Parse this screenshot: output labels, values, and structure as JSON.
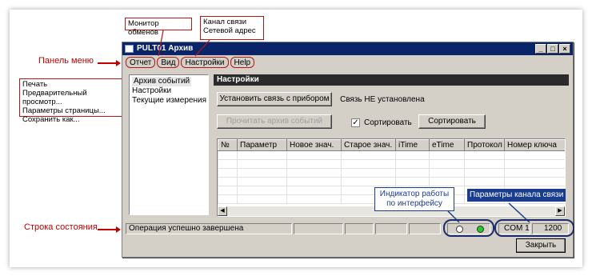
{
  "window": {
    "title": "PULT01 Архив",
    "controls": [
      "_",
      "□",
      "×"
    ]
  },
  "menu": [
    "Отчет",
    "Вид",
    "Настройки",
    "Help"
  ],
  "tree": [
    "Архив событий",
    "Настройки",
    "Текущие измерения"
  ],
  "panel": {
    "header": "Настройки",
    "connect_button": "Установить связь с прибором",
    "connect_status": "Связь НЕ установлена",
    "read_button": "Прочитать архив событий",
    "sort_checkbox_label": "Сортировать",
    "sort_checked": true,
    "sort_button": "Сортировать"
  },
  "table": {
    "columns": [
      "№",
      "Параметр",
      "Новое знач.",
      "Старое знач.",
      "iTime",
      "eTime",
      "Протокол",
      "Номер ключа"
    ]
  },
  "statusbar": {
    "message": "Операция успешно завершена",
    "port": "COM 1",
    "baud": "1200"
  },
  "close_button": "Закрыть",
  "annotations": {
    "monitor": "Монитор обменов",
    "channel_line1": "Канал связи",
    "channel_line2": "Сетевой адрес",
    "menu_panel": "Панель меню",
    "report_items": [
      "Печать",
      "Предварительный просмотр...",
      "Параметры страницы...",
      "Сохранить как..."
    ],
    "status_row": "Строка состояния",
    "indicator_line1": "Индикатор работы",
    "indicator_line2": "по интерфейсу",
    "channel_params": "Параметры канала связи"
  },
  "colors": {
    "annotation_red": "#c00000",
    "annotation_blue": "#1a3c8f",
    "titlebar": "#0a246a",
    "led_active": "#22cc22"
  }
}
